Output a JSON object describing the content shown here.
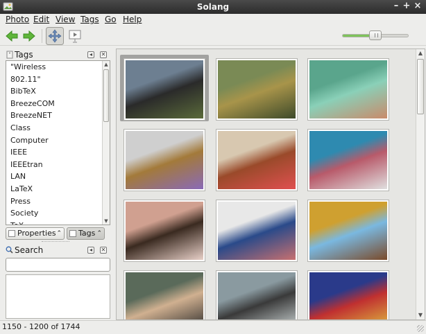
{
  "window": {
    "title": "Solang"
  },
  "menu": [
    "Photo",
    "Edit",
    "View",
    "Tags",
    "Go",
    "Help"
  ],
  "toolbar": {
    "icons": [
      "back-arrow-icon",
      "forward-arrow-icon",
      "browser-mode-icon",
      "slideshow-icon"
    ],
    "zoom_level": 0.52
  },
  "tags_panel": {
    "title": "Tags",
    "items": [
      "\"Wireless",
      "802.11\"",
      "BibTeX",
      "BreezeCOM",
      "BreezeNET",
      "Class",
      "Computer",
      "IEEE",
      "IEEEtran",
      "LAN",
      "LaTeX",
      "Press",
      "Society",
      "TeX"
    ]
  },
  "tabs": {
    "properties": "Properties",
    "tags": "Tags"
  },
  "search_panel": {
    "title": "Search",
    "value": ""
  },
  "status": {
    "text": "1150 - 1200 of 1744"
  },
  "photos": [
    {
      "name": "car-dashboard-road",
      "colors": [
        "#6d7f91",
        "#2a2a2a",
        "#5a6a3a"
      ]
    },
    {
      "name": "bulls-in-field",
      "colors": [
        "#7a8a55",
        "#a8944a",
        "#3d4a2a"
      ]
    },
    {
      "name": "woman-green-wall",
      "colors": [
        "#5aa58c",
        "#8ad0b8",
        "#c98a6a"
      ]
    },
    {
      "name": "flower-vase",
      "colors": [
        "#cfcfcf",
        "#a37a3a",
        "#8a6ab8"
      ]
    },
    {
      "name": "temple-shrine",
      "colors": [
        "#d8c8b0",
        "#9a4a2a",
        "#e05050"
      ]
    },
    {
      "name": "two-women-hug",
      "colors": [
        "#2e8ab0",
        "#b85a6a",
        "#e0e0e0"
      ]
    },
    {
      "name": "woman-portrait",
      "colors": [
        "#d0a090",
        "#3a2a20",
        "#e8d0c8"
      ]
    },
    {
      "name": "group-of-women",
      "colors": [
        "#e8e8e8",
        "#2a4a8a",
        "#c87070"
      ]
    },
    {
      "name": "house-doorway",
      "colors": [
        "#cfa030",
        "#7ab8e0",
        "#7a4a2a"
      ]
    },
    {
      "name": "two-old-women",
      "colors": [
        "#5a6a5a",
        "#d0b090",
        "#2a2a2a"
      ]
    },
    {
      "name": "back-of-car-seat",
      "colors": [
        "#8a9aa0",
        "#3a3a3a",
        "#d0d8d8"
      ]
    },
    {
      "name": "colorful-deity-idol",
      "colors": [
        "#2a3a8a",
        "#c03030",
        "#e0c040"
      ]
    }
  ]
}
